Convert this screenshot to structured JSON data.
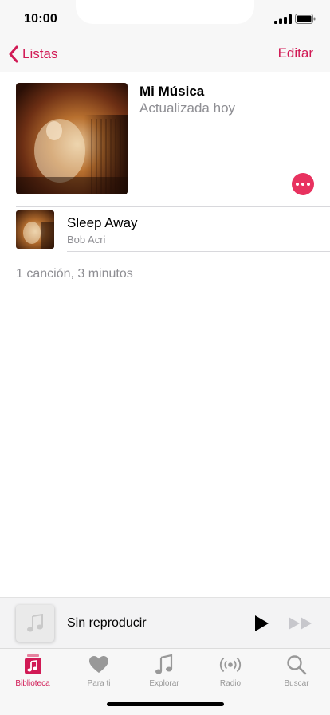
{
  "status": {
    "time": "10:00"
  },
  "nav": {
    "back_label": "Listas",
    "edit_label": "Editar"
  },
  "playlist": {
    "title": "Mi Música",
    "subtitle": "Actualizada hoy"
  },
  "songs": [
    {
      "title": "Sleep Away",
      "artist": "Bob Acri"
    }
  ],
  "summary": "1 canción, 3 minutos",
  "player": {
    "title": "Sin reproducir"
  },
  "tabs": [
    {
      "label": "Biblioteca",
      "icon": "library-icon",
      "active": true
    },
    {
      "label": "Para ti",
      "icon": "heart-icon"
    },
    {
      "label": "Explorar",
      "icon": "music-note-icon"
    },
    {
      "label": "Radio",
      "icon": "radio-icon"
    },
    {
      "label": "Buscar",
      "icon": "search-icon"
    }
  ],
  "colors": {
    "accent": "#d11a55",
    "more_button": "#e8325f",
    "secondary_text": "#8e8e93"
  }
}
